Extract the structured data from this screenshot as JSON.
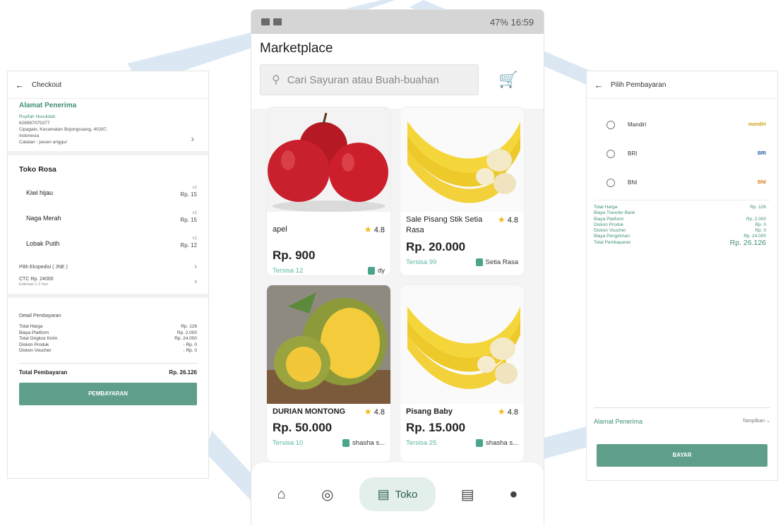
{
  "checkout": {
    "title": "Checkout",
    "recipient_heading": "Alamat Penerima",
    "recipient_name": "Rsyifah Nurulidah",
    "recipient_phone": "628987075377",
    "recipient_address1": "Cipagalo, Kecamatan Bojongsoang, 40287,",
    "recipient_address2": "Indonesia",
    "recipient_note": "Catatan : pesen anggur",
    "shop_name": "Toko Rosa",
    "items": [
      {
        "name": "Kiwi hijau",
        "qty": "x1",
        "price": "Rp. 15"
      },
      {
        "name": "Naga Merah",
        "qty": "x1",
        "price": "Rp. 15"
      },
      {
        "name": "Lobak Putih",
        "qty": "x1",
        "price": "Rp. 12"
      }
    ],
    "expedition": "Pilih Ekspedisi ( JNE )",
    "shipping_option": "CTC Rp. 24000",
    "shipping_estimate": "Estimasi 1-2 hari",
    "payment_detail_heading": "Detail Pembayaran",
    "payment_rows": [
      {
        "label": "Total Harga",
        "value": "Rp. 126"
      },
      {
        "label": "Biaya Platform",
        "value": "Rp. 2.000"
      },
      {
        "label": "Total Ongkos Kirim",
        "value": "Rp. 24.000"
      },
      {
        "label": "Diskon Produk",
        "value": "- Rp. 0"
      },
      {
        "label": "Diskon Voucher",
        "value": "- Rp. 0"
      }
    ],
    "total_label": "Total Pembayaran",
    "total_value": "Rp. 26.126",
    "button": "PEMBAYARAN"
  },
  "market": {
    "status_right": "47% 16:59",
    "title": "Marketplace",
    "search_placeholder": "Cari Sayuran atau Buah-buahan",
    "products": [
      {
        "name": "apel",
        "rating": "4.8",
        "price": "Rp. 900",
        "stock": "Tersisa 12",
        "seller": "dy"
      },
      {
        "name": "Sale Pisang Stik Setia Rasa",
        "rating": "4.8",
        "price": "Rp. 20.000",
        "stock": "Tersisa 99",
        "seller": "Setia Rasa"
      },
      {
        "name": "DURIAN MONTONG",
        "rating": "4.8",
        "price": "Rp. 50.000",
        "stock": "Tersisa 10",
        "seller": "shasha s..."
      },
      {
        "name": "Pisang Baby",
        "rating": "4.8",
        "price": "Rp. 15.000",
        "stock": "Tersisa 25",
        "seller": "shasha s..."
      }
    ],
    "nav_active_label": "Toko"
  },
  "payment": {
    "title": "Pilih Pembayaran",
    "banks": [
      {
        "name": "Mandiri",
        "logo": "mandiri"
      },
      {
        "name": "BRI",
        "logo": "BRI"
      },
      {
        "name": "BNI",
        "logo": "BNI"
      }
    ],
    "rows": [
      {
        "label": "Total Harga",
        "value": "Rp. 126"
      },
      {
        "label": "Biaya Transfer Bank",
        "value": ""
      },
      {
        "label": "Biaya Platform",
        "value": "Rp. 2.000"
      },
      {
        "label": "Diskon Produk",
        "value": "Rp. 0"
      },
      {
        "label": "Diskon Voucher",
        "value": "Rp. 0"
      },
      {
        "label": "Biaya Pengiriman",
        "value": "Rp. 24.000"
      }
    ],
    "total_label": "Total Pembayaran",
    "total_value": "Rp. 26.126",
    "address_label": "Alamat Penerima",
    "address_action": "Tampilkan",
    "button": "BAYAR"
  },
  "colors": {
    "accent": "#5f9e8b",
    "accent_text": "#3f8f77",
    "star": "#f2b70d"
  }
}
